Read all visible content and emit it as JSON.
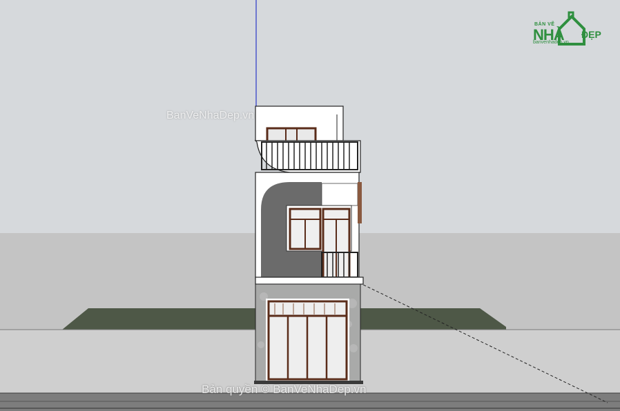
{
  "logo": {
    "small_text": "BẢN VẼ",
    "big_text": "NHÀ",
    "suffix_text": "ĐẸP",
    "url_text": "banvenhadep.vn"
  },
  "watermarks": {
    "top": "BanVeNhaDep.vn",
    "bottom": "Bản quyền © BanVeNhaDep.vn"
  },
  "colors": {
    "sky": "#d6d9dc",
    "ground": "#c9c9c9",
    "lawn": "#4e5847",
    "road": "#7c7c7c",
    "facade_white": "#ffffff",
    "facade_grey": "#6b6b6b",
    "stone": "#a9aaa9",
    "frame_brown": "#5a2c1a",
    "railing": "#2a2a2a",
    "logo_green": "#2f8f3f"
  }
}
